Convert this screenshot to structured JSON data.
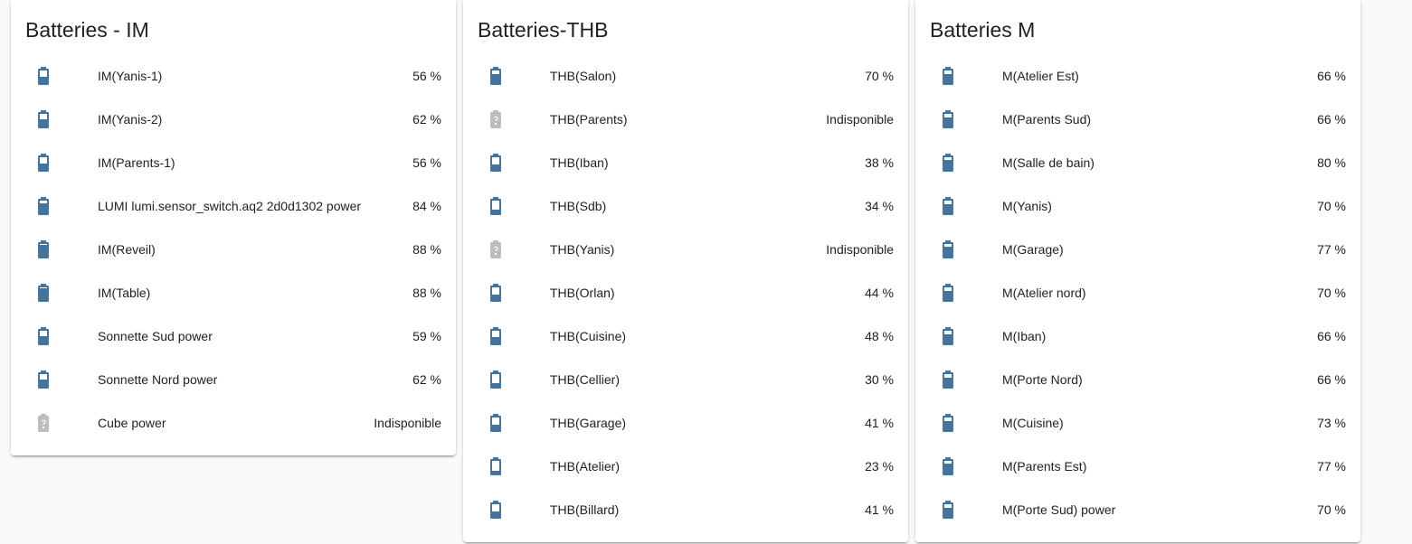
{
  "colors": {
    "battery": "#44739e",
    "unavailable": "#bdbdbd"
  },
  "cards": [
    {
      "title": "Batteries - IM",
      "rows": [
        {
          "name": "IM(Yanis-1)",
          "value": "56 %",
          "icon": "battery-50-icon"
        },
        {
          "name": "IM(Yanis-2)",
          "value": "62 %",
          "icon": "battery-60-icon"
        },
        {
          "name": "IM(Parents-1)",
          "value": "56 %",
          "icon": "battery-50-icon"
        },
        {
          "name": "LUMI lumi.sensor_switch.aq2 2d0d1302 power",
          "value": "84 %",
          "icon": "battery-80-icon"
        },
        {
          "name": "IM(Reveil)",
          "value": "88 %",
          "icon": "battery-90-icon"
        },
        {
          "name": "IM(Table)",
          "value": "88 %",
          "icon": "battery-90-icon"
        },
        {
          "name": "Sonnette Sud power",
          "value": "59 %",
          "icon": "battery-60-icon"
        },
        {
          "name": "Sonnette Nord power",
          "value": "62 %",
          "icon": "battery-60-icon"
        },
        {
          "name": "Cube power",
          "value": "Indisponible",
          "icon": "battery-unknown-icon"
        }
      ]
    },
    {
      "title": "Batteries-THB",
      "rows": [
        {
          "name": "THB(Salon)",
          "value": "70 %",
          "icon": "battery-70-icon"
        },
        {
          "name": "THB(Parents)",
          "value": "Indisponible",
          "icon": "battery-unknown-icon"
        },
        {
          "name": "THB(Iban)",
          "value": "38 %",
          "icon": "battery-40-icon"
        },
        {
          "name": "THB(Sdb)",
          "value": "34 %",
          "icon": "battery-30-icon"
        },
        {
          "name": "THB(Yanis)",
          "value": "Indisponible",
          "icon": "battery-unknown-icon"
        },
        {
          "name": "THB(Orlan)",
          "value": "44 %",
          "icon": "battery-40-icon"
        },
        {
          "name": "THB(Cuisine)",
          "value": "48 %",
          "icon": "battery-50-icon"
        },
        {
          "name": "THB(Cellier)",
          "value": "30 %",
          "icon": "battery-30-icon"
        },
        {
          "name": "THB(Garage)",
          "value": "41 %",
          "icon": "battery-40-icon"
        },
        {
          "name": "THB(Atelier)",
          "value": "23 %",
          "icon": "battery-20-icon"
        },
        {
          "name": "THB(Billard)",
          "value": "41 %",
          "icon": "battery-40-icon"
        }
      ]
    },
    {
      "title": "Batteries M",
      "rows": [
        {
          "name": "M(Atelier Est)",
          "value": "66 %",
          "icon": "battery-70-icon"
        },
        {
          "name": "M(Parents Sud)",
          "value": "66 %",
          "icon": "battery-70-icon"
        },
        {
          "name": "M(Salle de bain)",
          "value": "80 %",
          "icon": "battery-80-icon"
        },
        {
          "name": "M(Yanis)",
          "value": "70 %",
          "icon": "battery-70-icon"
        },
        {
          "name": "M(Garage)",
          "value": "77 %",
          "icon": "battery-80-icon"
        },
        {
          "name": "M(Atelier nord)",
          "value": "70 %",
          "icon": "battery-70-icon"
        },
        {
          "name": "M(Iban)",
          "value": "66 %",
          "icon": "battery-70-icon"
        },
        {
          "name": "M(Porte Nord)",
          "value": "66 %",
          "icon": "battery-70-icon"
        },
        {
          "name": "M(Cuisine)",
          "value": "73 %",
          "icon": "battery-70-icon"
        },
        {
          "name": "M(Parents Est)",
          "value": "77 %",
          "icon": "battery-80-icon"
        },
        {
          "name": "M(Porte Sud) power",
          "value": "70 %",
          "icon": "battery-70-icon"
        }
      ]
    }
  ]
}
